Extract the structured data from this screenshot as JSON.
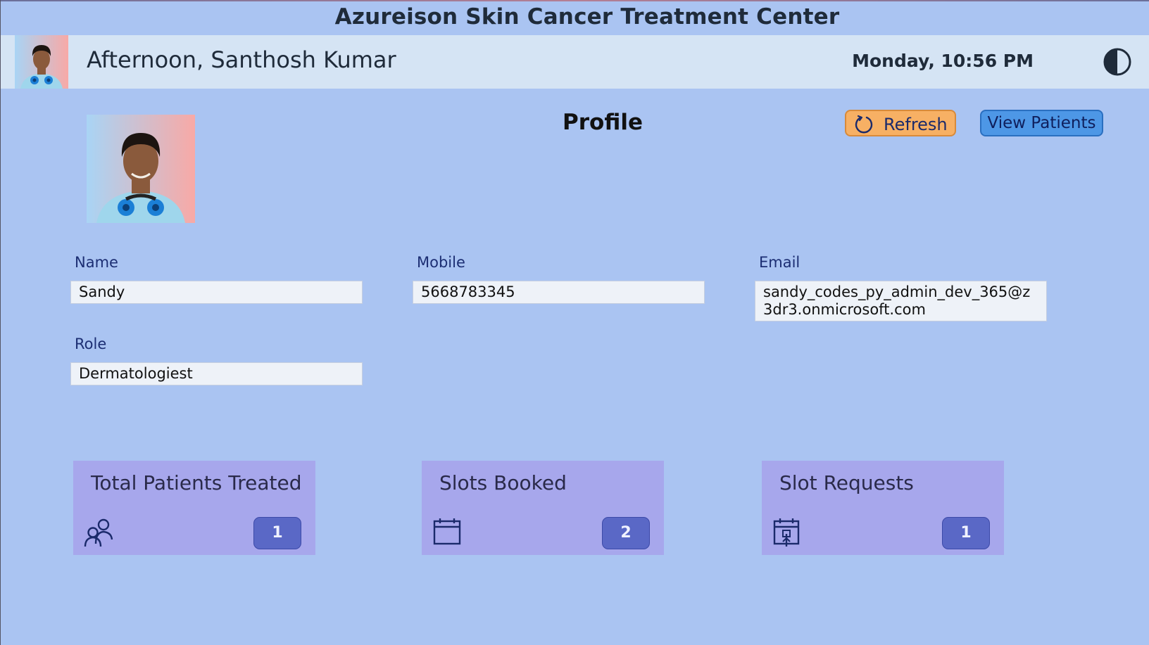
{
  "app": {
    "title": "Azureison Skin Cancer Treatment Center"
  },
  "header": {
    "greeting": "Afternoon, Santhosh Kumar",
    "datetime": "Monday, 10:56 PM",
    "theme_toggle_icon": "contrast-icon"
  },
  "profile": {
    "title": "Profile",
    "refresh_label": "Refresh",
    "refresh_icon": "refresh-icon",
    "view_patients_label": "View Patients"
  },
  "fields": {
    "name": {
      "label": "Name",
      "value": "Sandy"
    },
    "mobile": {
      "label": "Mobile",
      "value": "5668783345"
    },
    "email": {
      "label": "Email",
      "value": "sandy_codes_py_admin_dev_365@z3dr3.onmicrosoft.com"
    },
    "role": {
      "label": "Role",
      "value": "Dermatologiest"
    }
  },
  "stats": [
    {
      "title": "Total Patients Treated",
      "icon": "people-icon",
      "count": "1"
    },
    {
      "title": "Slots Booked",
      "icon": "calendar-icon",
      "count": "2"
    },
    {
      "title": "Slot Requests",
      "icon": "calendar-request-icon",
      "count": "1"
    }
  ],
  "colors": {
    "background": "#aac4f2",
    "header": "#d5e4f4",
    "refresh_button": "#f7b064",
    "view_button": "#4d97e6",
    "card": "#a7a7ec",
    "badge": "#5a68c6"
  }
}
